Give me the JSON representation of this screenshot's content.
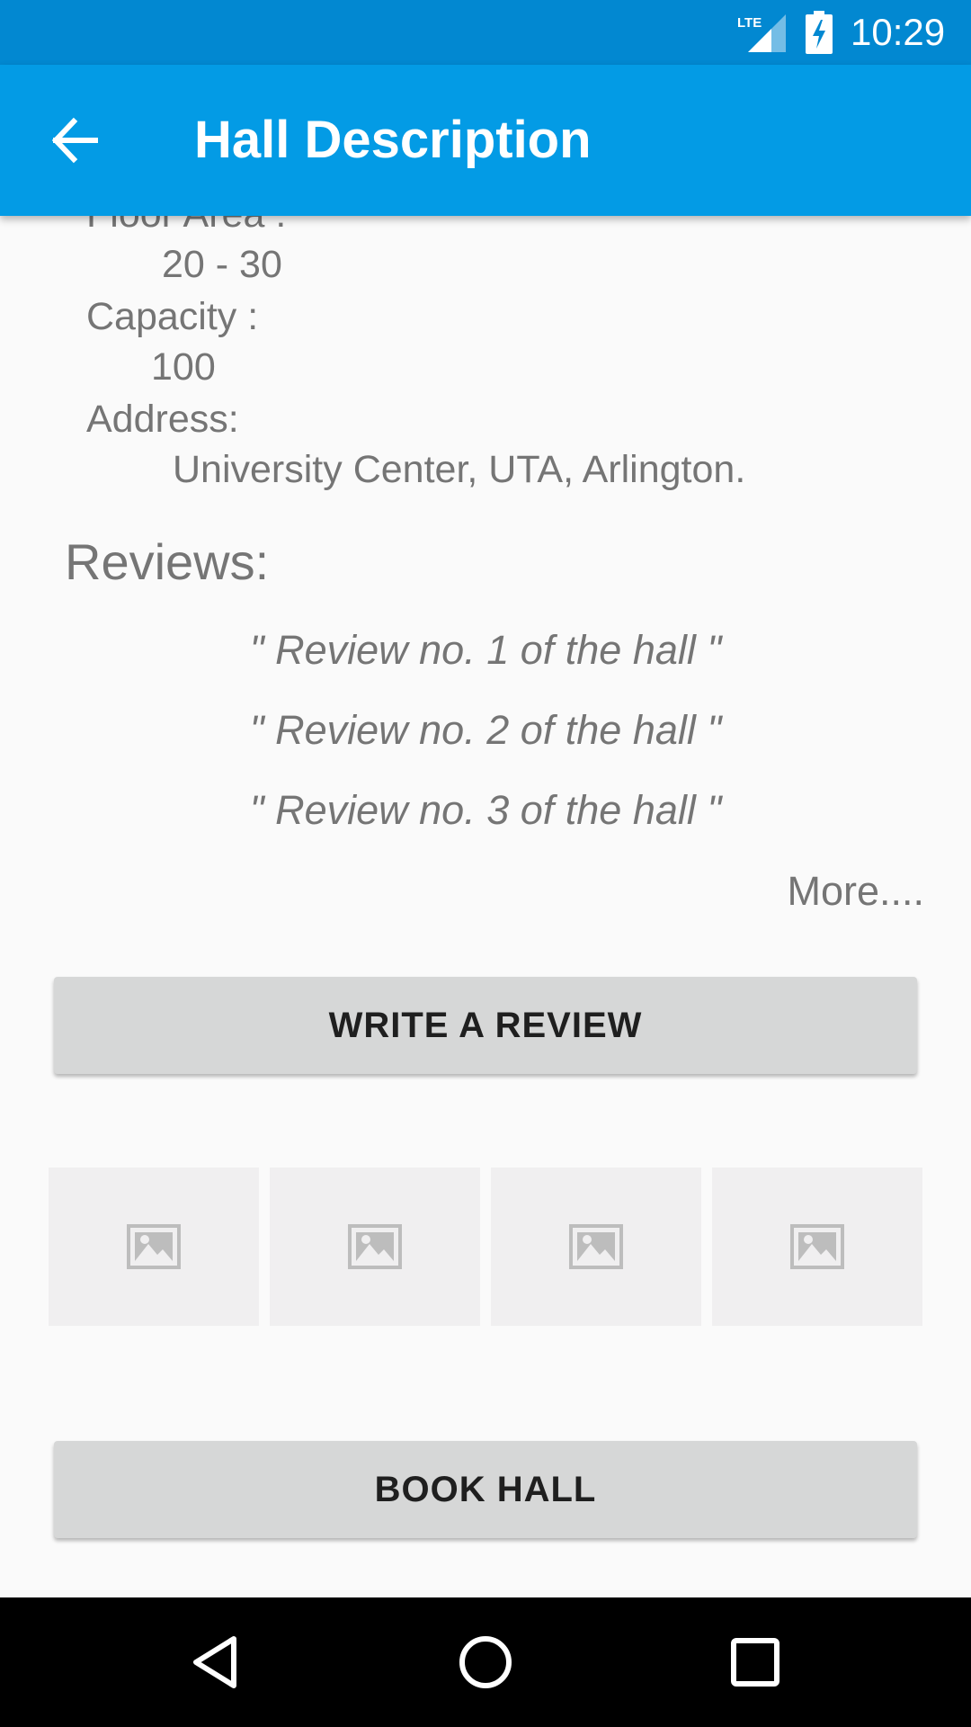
{
  "status_bar": {
    "time": "10:29",
    "network_label": "LTE",
    "background": "#0288d1"
  },
  "app_bar": {
    "title": "Hall Description",
    "background": "#039be5",
    "back_icon": "arrow-back-icon"
  },
  "details": {
    "floor_area_label": "Floor Area :",
    "floor_area_value": "20 - 30",
    "capacity_label": "Capacity :",
    "capacity_value": "100",
    "address_label": "Address:",
    "address_value": "University Center, UTA, Arlington."
  },
  "reviews": {
    "heading": "Reviews:",
    "items": [
      "\" Review no. 1 of the hall \"",
      "\" Review no. 2 of the hall \"",
      "\" Review no. 3 of the hall \""
    ],
    "more_label": "More...."
  },
  "buttons": {
    "write_review": "WRITE A REVIEW",
    "book_hall": "BOOK HALL"
  },
  "gallery": {
    "thumbnails": [
      "image-placeholder-icon",
      "image-placeholder-icon",
      "image-placeholder-icon",
      "image-placeholder-icon"
    ]
  },
  "nav_bar": {
    "back": "nav-back-icon",
    "home": "nav-home-icon",
    "recents": "nav-recents-icon"
  }
}
